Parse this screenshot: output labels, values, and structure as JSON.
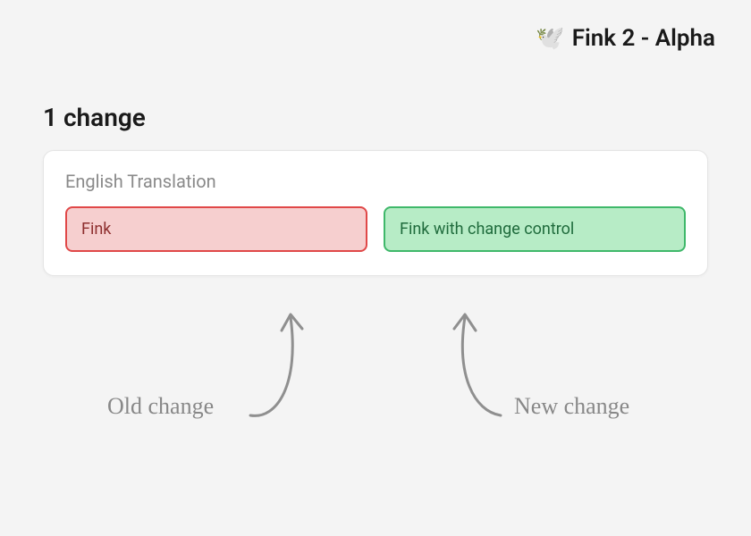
{
  "header": {
    "icon": "🕊️",
    "title": "Fink 2 - Alpha"
  },
  "summary": {
    "count_label": "1 change"
  },
  "card": {
    "title": "English Translation",
    "old_value": "Fink",
    "new_value": "Fink with change control"
  },
  "annotations": {
    "old": "Old change",
    "new": "New change"
  }
}
